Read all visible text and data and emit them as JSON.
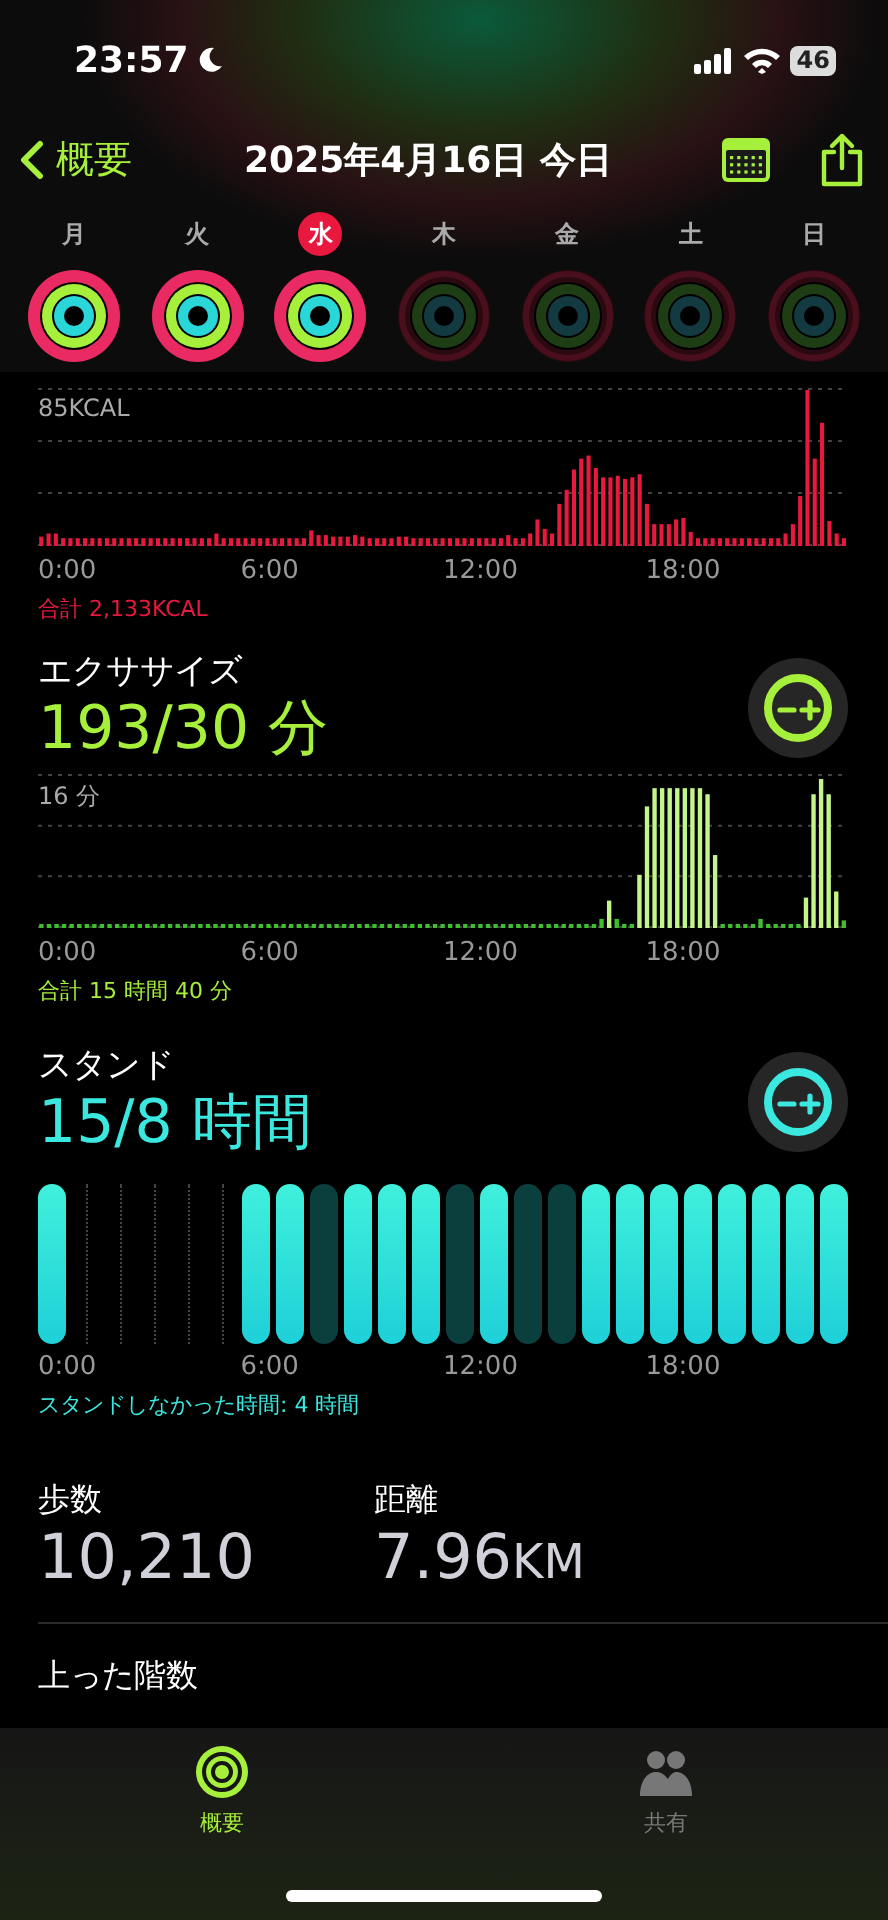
{
  "status_bar": {
    "time": "23:57",
    "battery": "46"
  },
  "nav": {
    "back": "概要",
    "title": "2025年4月16日 今日"
  },
  "week": [
    {
      "day": "月",
      "selected": false,
      "dimmed": false
    },
    {
      "day": "火",
      "selected": false,
      "dimmed": false
    },
    {
      "day": "水",
      "selected": true,
      "dimmed": false
    },
    {
      "day": "木",
      "selected": false,
      "dimmed": true
    },
    {
      "day": "金",
      "selected": false,
      "dimmed": true
    },
    {
      "day": "土",
      "selected": false,
      "dimmed": true
    },
    {
      "day": "日",
      "selected": false,
      "dimmed": true
    }
  ],
  "move": {
    "max_label": "85KCAL",
    "x_labels": [
      "0:00",
      "6:00",
      "12:00",
      "18:00"
    ],
    "total": "合計 2,133KCAL"
  },
  "exercise": {
    "title": "エクササイズ",
    "value": "193/30 分",
    "max_label": "16 分",
    "x_labels": [
      "0:00",
      "6:00",
      "12:00",
      "18:00"
    ],
    "total": "合計 15 時間 40 分"
  },
  "stand": {
    "title": "スタンド",
    "value": "15/8 時間",
    "x_labels": [
      "0:00",
      "6:00",
      "12:00",
      "18:00"
    ],
    "note": "スタンドしなかった時間: 4 時間",
    "hours": [
      {
        "kind": "stood"
      },
      {
        "kind": "none"
      },
      {
        "kind": "none"
      },
      {
        "kind": "none"
      },
      {
        "kind": "none"
      },
      {
        "kind": "none"
      },
      {
        "kind": "stood"
      },
      {
        "kind": "stood"
      },
      {
        "kind": "missed"
      },
      {
        "kind": "stood"
      },
      {
        "kind": "stood"
      },
      {
        "kind": "stood"
      },
      {
        "kind": "missed"
      },
      {
        "kind": "stood"
      },
      {
        "kind": "missed"
      },
      {
        "kind": "missed"
      },
      {
        "kind": "stood"
      },
      {
        "kind": "stood"
      },
      {
        "kind": "stood"
      },
      {
        "kind": "stood"
      },
      {
        "kind": "stood"
      },
      {
        "kind": "stood"
      },
      {
        "kind": "stood"
      },
      {
        "kind": "stood"
      }
    ]
  },
  "stats": [
    {
      "label": "歩数",
      "value": "10,210"
    },
    {
      "label": "距離",
      "value": "7.96",
      "unit": "KM"
    }
  ],
  "floors": {
    "label": "上った階数"
  },
  "tabbar": [
    {
      "label": "概要",
      "selected": true
    },
    {
      "label": "共有",
      "selected": false
    }
  ]
}
